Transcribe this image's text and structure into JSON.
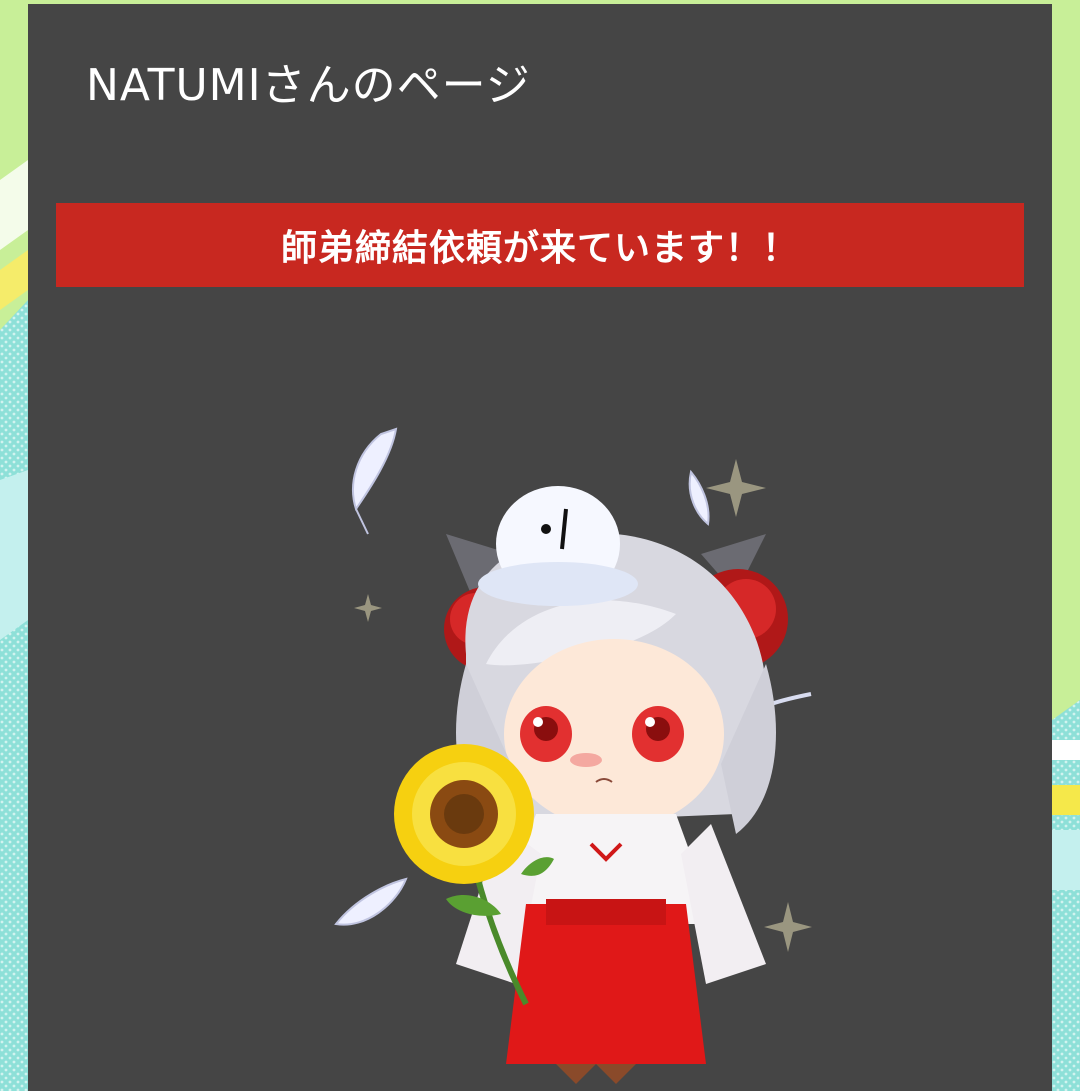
{
  "page": {
    "title": "NATUMIさんのページ"
  },
  "banner": {
    "text": "師弟締結依頼が来ています！！",
    "color": "#c82820"
  },
  "panel": {
    "background": "#454545"
  },
  "avatar": {
    "icon": "chibi-shrine-maiden-avatar",
    "items": [
      "sunflower",
      "white-bird",
      "red-flower-hair-ornament",
      "feathers",
      "sparkles"
    ]
  }
}
